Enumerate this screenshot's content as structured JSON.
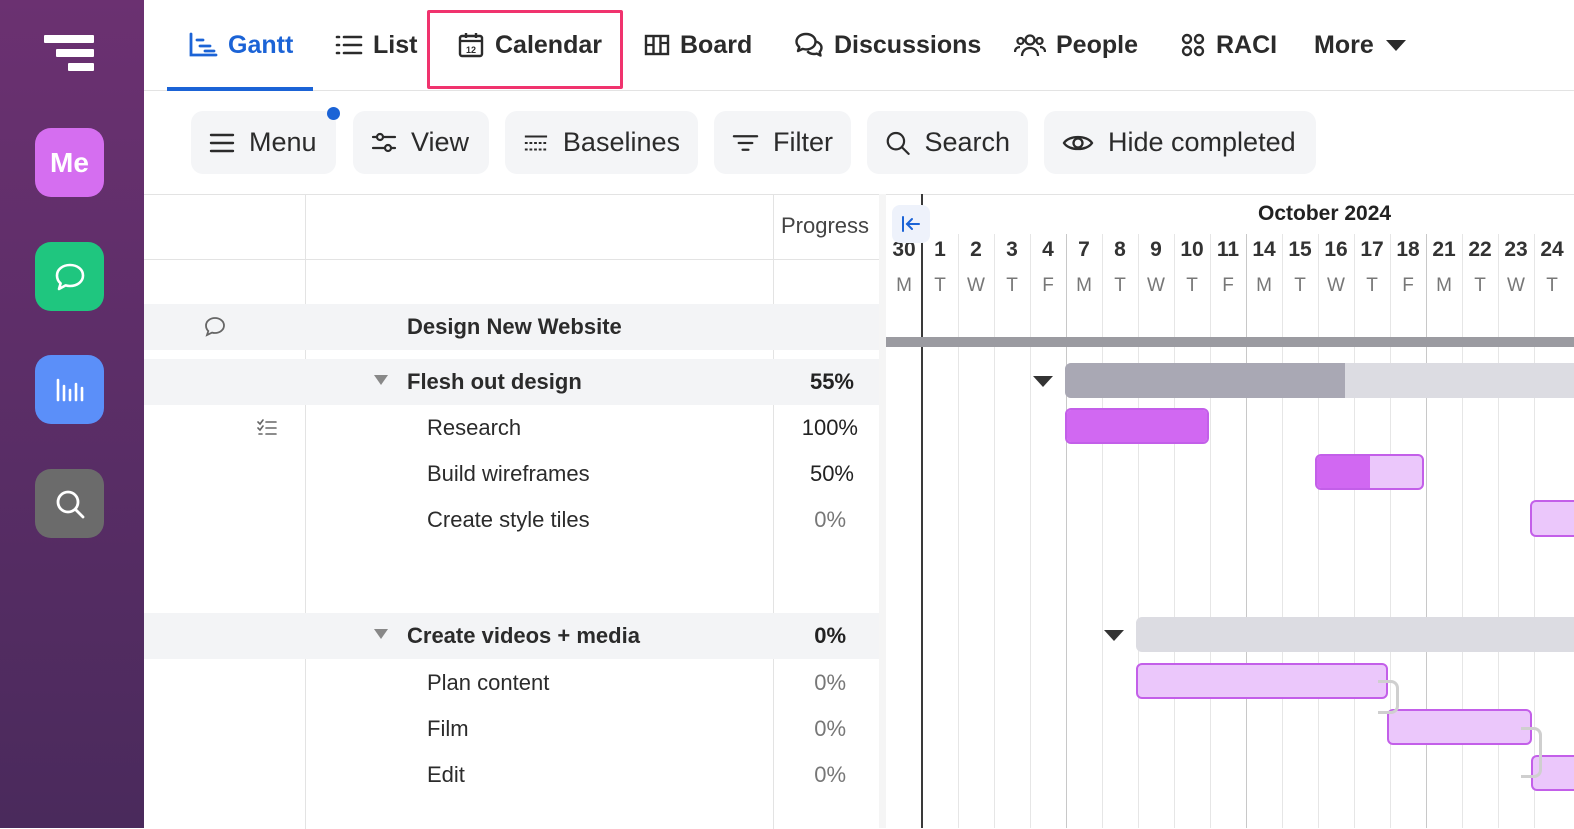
{
  "sidebar": {
    "logo": "logo",
    "buttons": [
      {
        "label": "Me",
        "color": "#d56ef0"
      },
      {
        "icon": "chat-bubble-icon",
        "color": "#1fc67f"
      },
      {
        "icon": "bar-chart-icon",
        "color": "#5b8ff9"
      },
      {
        "icon": "search-icon",
        "color": "#6b6b6b"
      }
    ]
  },
  "tabs": {
    "gantt": "Gantt",
    "list": "List",
    "calendar": "Calendar",
    "board": "Board",
    "discussions": "Discussions",
    "people": "People",
    "raci": "RACI",
    "more": "More",
    "active": "Gantt",
    "active_color": "#1b63d6",
    "highlight_color": "#f0336e"
  },
  "toolbar": {
    "menu": "Menu",
    "view": "View",
    "baselines": "Baselines",
    "filter": "Filter",
    "search": "Search",
    "hide_completed": "Hide completed"
  },
  "grid": {
    "progress_header": "Progress",
    "project": {
      "name": "Design New Website"
    },
    "groups": [
      {
        "name": "Flesh out design",
        "progress": "55%",
        "tasks": [
          {
            "name": "Research",
            "progress": "100%"
          },
          {
            "name": "Build wireframes",
            "progress": "50%"
          },
          {
            "name": "Create style tiles",
            "progress": "0%"
          }
        ]
      },
      {
        "name": "Create videos + media",
        "progress": "0%",
        "tasks": [
          {
            "name": "Plan content",
            "progress": "0%"
          },
          {
            "name": "Film",
            "progress": "0%"
          },
          {
            "name": "Edit",
            "progress": "0%"
          }
        ]
      }
    ]
  },
  "timeline": {
    "month": "October 2024",
    "days": [
      {
        "num": "30",
        "dow": "M"
      },
      {
        "num": "1",
        "dow": "T"
      },
      {
        "num": "2",
        "dow": "W"
      },
      {
        "num": "3",
        "dow": "T"
      },
      {
        "num": "4",
        "dow": "F"
      },
      {
        "num": "7",
        "dow": "M"
      },
      {
        "num": "8",
        "dow": "T"
      },
      {
        "num": "9",
        "dow": "W"
      },
      {
        "num": "10",
        "dow": "T"
      },
      {
        "num": "11",
        "dow": "F"
      },
      {
        "num": "14",
        "dow": "M"
      },
      {
        "num": "15",
        "dow": "T"
      },
      {
        "num": "16",
        "dow": "W"
      },
      {
        "num": "17",
        "dow": "T"
      },
      {
        "num": "18",
        "dow": "F"
      },
      {
        "num": "21",
        "dow": "M"
      },
      {
        "num": "22",
        "dow": "T"
      },
      {
        "num": "23",
        "dow": "W"
      },
      {
        "num": "24",
        "dow": "T"
      }
    ],
    "bars": [
      {
        "name": "Flesh out design",
        "kind": "summary",
        "progress": 0.55
      },
      {
        "name": "Research",
        "kind": "task",
        "progress": 1.0
      },
      {
        "name": "Build wireframes",
        "kind": "task",
        "progress": 0.5
      },
      {
        "name": "Create style tiles",
        "kind": "task",
        "progress": 0.0
      },
      {
        "name": "Create videos + media",
        "kind": "summary",
        "progress": 0.0
      },
      {
        "name": "Plan content",
        "kind": "task",
        "progress": 0.0
      },
      {
        "name": "Film",
        "kind": "task",
        "progress": 0.0
      },
      {
        "name": "Edit",
        "kind": "task",
        "progress": 0.0
      }
    ],
    "colors": {
      "summary": "#dcdce2",
      "summary_progress": "#a9a8b4",
      "task": "#ebc7fb",
      "task_progress": "#d168f2",
      "task_border": "#c35fe9"
    }
  }
}
